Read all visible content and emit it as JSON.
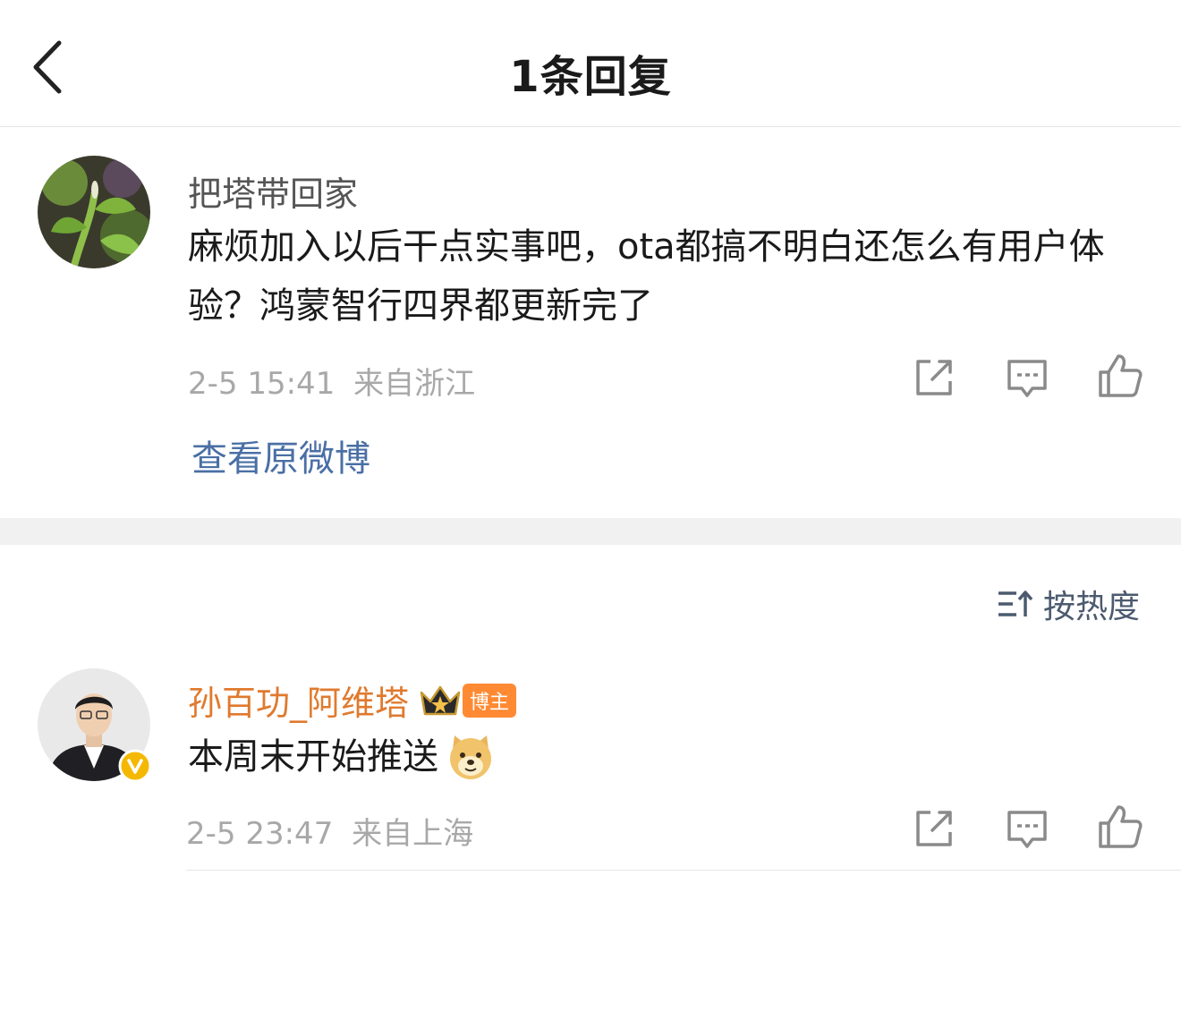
{
  "header": {
    "title": "1条回复"
  },
  "original_comment": {
    "username": "把塔带回家",
    "text": "麻烦加入以后干点实事吧，ota都搞不明白还怎么有用户体验？鸿蒙智行四界都更新完了",
    "time": "2-5 15:41",
    "location": "来自浙江",
    "view_original_label": "查看原微博"
  },
  "sort": {
    "label": "按热度"
  },
  "reply": {
    "username": "孙百功_阿维塔",
    "badge_label": "博主",
    "text": "本周末开始推送",
    "time": "2-5 23:47",
    "location": "来自上海"
  },
  "colors": {
    "reply_username": "#e07a2e",
    "username": "#555555",
    "meta": "#a8a8a8",
    "link": "#4a6fa5",
    "icon": "#8a8a8a"
  },
  "icons": [
    "back-arrow-icon",
    "share-icon",
    "comment-icon",
    "like-icon",
    "sort-icon",
    "crown-icon",
    "verified-icon",
    "doge-emoji-icon"
  ]
}
